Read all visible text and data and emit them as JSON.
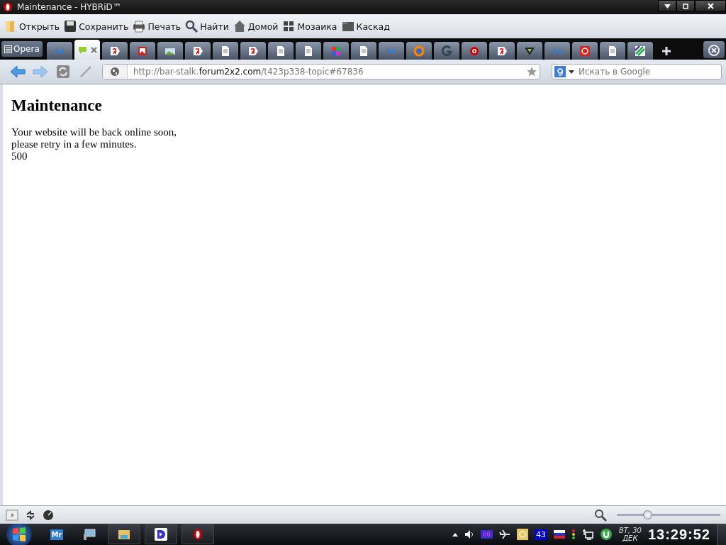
{
  "window": {
    "title": "Maintenance - HYBRiD™"
  },
  "toolbar": [
    {
      "label": "Открыть",
      "kind": "folder"
    },
    {
      "label": "Сохранить",
      "kind": "disk"
    },
    {
      "label": "Печать",
      "kind": "printer"
    },
    {
      "label": "Найти",
      "kind": "magnifier"
    },
    {
      "label": "Домой",
      "kind": "house"
    },
    {
      "label": "Мозаика",
      "kind": "tiles"
    },
    {
      "label": "Каскад",
      "kind": "cascade"
    }
  ],
  "menu_button": {
    "label": "Opera"
  },
  "tabs": [
    {
      "kind": "butterfly",
      "selected": false
    },
    {
      "kind": "speech",
      "selected": true
    },
    {
      "kind": "yandex",
      "selected": false
    },
    {
      "kind": "picture",
      "selected": false
    },
    {
      "kind": "landscape",
      "selected": false
    },
    {
      "kind": "yandex",
      "selected": false
    },
    {
      "kind": "page",
      "selected": false
    },
    {
      "kind": "yandex",
      "selected": false
    },
    {
      "kind": "page",
      "selected": false
    },
    {
      "kind": "page",
      "selected": false
    },
    {
      "kind": "puzzle",
      "selected": false
    },
    {
      "kind": "page",
      "selected": false
    },
    {
      "kind": "butterfly",
      "selected": false
    },
    {
      "kind": "ring",
      "selected": false
    },
    {
      "kind": "letter",
      "selected": false
    },
    {
      "kind": "target",
      "selected": false
    },
    {
      "kind": "yandex",
      "selected": false
    },
    {
      "kind": "triangle",
      "selected": false
    },
    {
      "kind": "butterfly",
      "selected": false
    },
    {
      "kind": "redsquare",
      "selected": false
    },
    {
      "kind": "page",
      "selected": false
    },
    {
      "kind": "stripes",
      "selected": false
    }
  ],
  "address_bar": {
    "url": [
      {
        "text": "http://bar-stalk.",
        "strong": false
      },
      {
        "text": "forum2x2.com",
        "strong": true
      },
      {
        "text": "/t423p338-topic#67836",
        "strong": false
      }
    ]
  },
  "search": {
    "placeholder": "Искать в Google"
  },
  "page": {
    "heading": "Maintenance",
    "lines": [
      "Your website will be back online soon,",
      "please retry in a few minutes."
    ],
    "code": "500"
  },
  "zoom": {
    "level": 0.28
  },
  "taskbar": {
    "apps": [
      {
        "kind": "mr",
        "label": "Mr"
      },
      {
        "kind": "monitor"
      },
      {
        "kind": "explorer"
      },
      {
        "kind": "d"
      },
      {
        "kind": "opera"
      }
    ],
    "tray_fps": "60",
    "tray_count": "43",
    "date_day": "ВТ, 30",
    "date_month": "ДЕК",
    "time": "13:29:52"
  }
}
